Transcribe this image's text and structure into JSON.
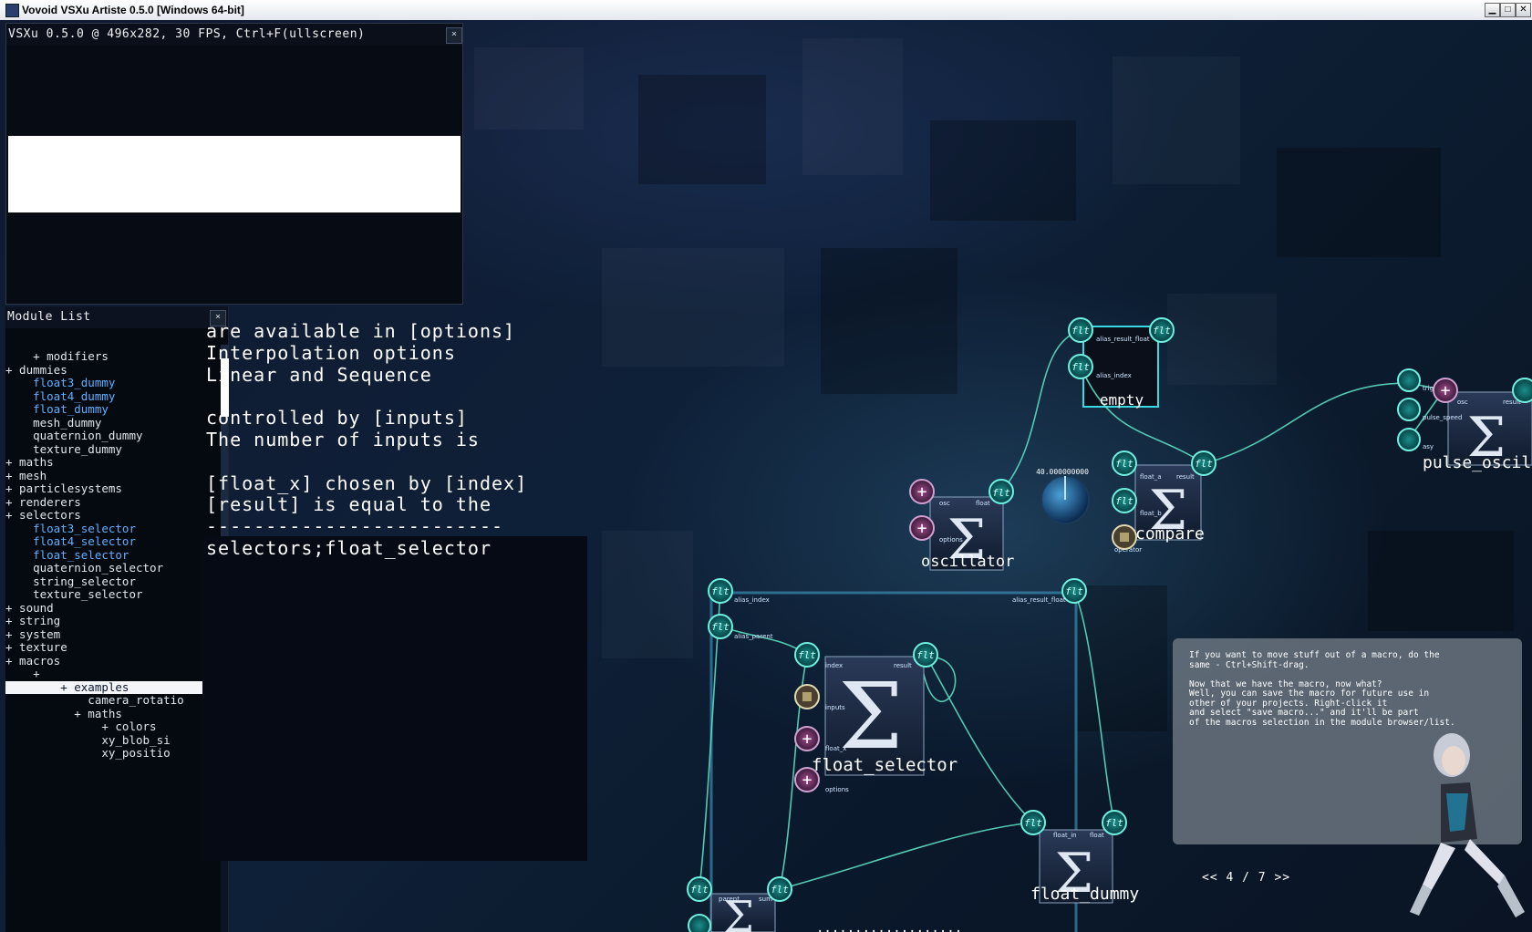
{
  "window": {
    "title": "Vovoid VSXu Artiste 0.5.0 [Windows 64-bit]",
    "minimize": "▁",
    "maximize": "□",
    "close": "✕"
  },
  "preview": {
    "title": "VSXu 0.5.0 @ 496x282, 30 FPS, Ctrl+F(ullscreen)",
    "close": "×"
  },
  "module_list": {
    "title": "Module List",
    "close": "×",
    "items": [
      {
        "text": "    + modifiers",
        "style": "normal"
      },
      {
        "text": "+ dummies",
        "style": "normal"
      },
      {
        "text": "    float3_dummy",
        "style": "hl"
      },
      {
        "text": "    float4_dummy",
        "style": "hl"
      },
      {
        "text": "    float_dummy",
        "style": "hl"
      },
      {
        "text": "    mesh_dummy",
        "style": "normal"
      },
      {
        "text": "    quaternion_dummy",
        "style": "normal"
      },
      {
        "text": "    texture_dummy",
        "style": "normal"
      },
      {
        "text": "+ maths",
        "style": "normal"
      },
      {
        "text": "+ mesh",
        "style": "normal"
      },
      {
        "text": "+ particlesystems",
        "style": "normal"
      },
      {
        "text": "+ renderers",
        "style": "normal"
      },
      {
        "text": "+ selectors",
        "style": "normal"
      },
      {
        "text": "    float3_selector",
        "style": "hl"
      },
      {
        "text": "    float4_selector",
        "style": "hl"
      },
      {
        "text": "    float_selector",
        "style": "hl"
      },
      {
        "text": "    quaternion_selector",
        "style": "normal"
      },
      {
        "text": "    string_selector",
        "style": "normal"
      },
      {
        "text": "    texture_selector",
        "style": "normal"
      },
      {
        "text": "+ sound",
        "style": "normal"
      },
      {
        "text": "+ string",
        "style": "normal"
      },
      {
        "text": "+ system",
        "style": "normal"
      },
      {
        "text": "+ texture",
        "style": "normal"
      },
      {
        "text": "+ macros",
        "style": "normal"
      },
      {
        "text": "    +",
        "style": "normal"
      },
      {
        "text": "        + examples",
        "style": "sel"
      },
      {
        "text": "            camera_rotatio",
        "style": "normal"
      },
      {
        "text": "          + maths",
        "style": "normal"
      },
      {
        "text": "              + colors",
        "style": "normal"
      },
      {
        "text": "              xy_blob_si",
        "style": "normal"
      },
      {
        "text": "              xy_positio",
        "style": "normal"
      }
    ]
  },
  "help": {
    "lines": [
      "are available in [options]",
      "Interpolation options",
      "Linear and Sequence",
      "",
      "controlled by [inputs]",
      "The number of inputs is",
      "",
      "[float_x] chosen by [index]",
      "[result] is equal to the",
      "-------------------------",
      "selectors;float_selector"
    ]
  },
  "nodes": {
    "empty": {
      "title": "empty",
      "ports": [
        "alias_result_float",
        "alias_index"
      ]
    },
    "oscillator": {
      "title": "oscillator",
      "ports": [
        "osc",
        "float",
        "options"
      ]
    },
    "compare": {
      "title": "compare",
      "ports": [
        "float_a",
        "result",
        "float_b",
        "operator"
      ]
    },
    "pulse": {
      "title": "pulse_oscillat",
      "ports": [
        "trigger",
        "osc",
        "result",
        "pulse_speed",
        "asy"
      ]
    },
    "float_selector": {
      "title": "float_selector",
      "ports": [
        "index",
        "result",
        "inputs",
        "float_x",
        "options"
      ]
    },
    "float_dummy": {
      "title": "float_dummy",
      "ports": [
        "float_in",
        "float"
      ]
    },
    "macro_ports": [
      "alias_index",
      "alias_parent",
      "alias_result_float"
    ],
    "bottom_ports": [
      "parent",
      "sum"
    ],
    "bottom_partial": "...................",
    "knob_value": "40.000000000"
  },
  "tutorial": {
    "text": "If you want to move stuff out of a macro, do the\nsame - Ctrl+Shift-drag.\n\nNow that we have the macro, now what?\nWell, you can save the macro for future use in\nother of your projects. Right-click it\nand select \"save macro...\" and it'll be part\nof the macros selection in the module browser/list.",
    "prev": "<<",
    "page": "4 / 7",
    "next": ">>"
  },
  "colors": {
    "wire": "#5fe8c8",
    "port_fill": "#0c6a6a",
    "port_ring": "#6ff0e0",
    "add_port": "#7a3a6a",
    "accent": "#5fb0ff"
  }
}
